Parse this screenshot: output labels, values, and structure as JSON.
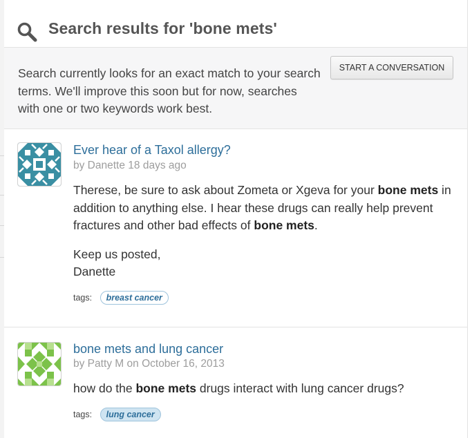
{
  "header": {
    "title": "Search results for 'bone mets'",
    "icon": "search-icon"
  },
  "notice": {
    "text": "Search currently looks for an exact match to your search terms. We'll improve this soon but for now, searches with one or two keywords work best.",
    "button_label": "START A CONVERSATION"
  },
  "results": [
    {
      "title": "Ever hear of a Taxol allergy?",
      "author_prefix": "by Danette",
      "date": "18 days ago",
      "body_parts": [
        "Therese, be sure to ask about Zometa or Xgeva for your ",
        "bone mets",
        " in addition to anything else. I hear these drugs can really help prevent fractures and other bad effects of ",
        "bone mets",
        "."
      ],
      "body_line2": "Keep us posted,",
      "body_line3": "Danette",
      "tags_label": "tags:",
      "tags": [
        "breast cancer"
      ],
      "avatar_color": "#3a8fa3"
    },
    {
      "title": "bone mets and lung cancer",
      "author_prefix": "by Patty M on",
      "date": "October 16, 2013",
      "body_parts": [
        "how do the ",
        "bone mets",
        " drugs interact with lung cancer drugs?"
      ],
      "tags_label": "tags:",
      "tags": [
        "lung cancer"
      ],
      "avatar_color": "#7cc24a"
    }
  ],
  "colors": {
    "link": "#2d6e9a",
    "notice_bg": "#f6f6f7",
    "tag_active_bg": "#cfe4f1"
  }
}
